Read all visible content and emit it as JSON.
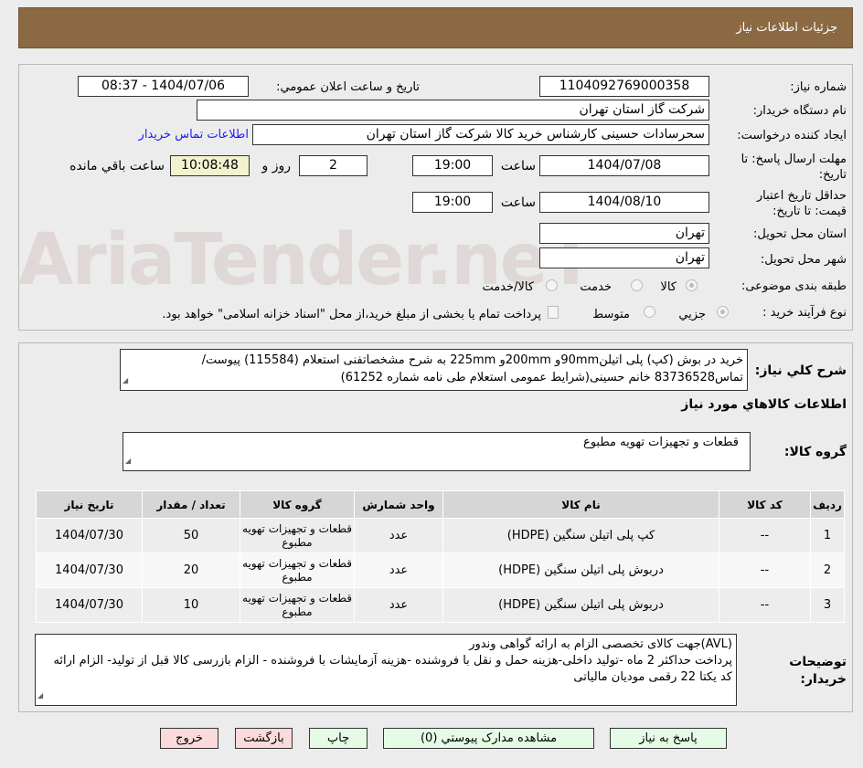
{
  "header": {
    "title": "جزئيات اطلاعات نياز"
  },
  "watermark": "AriaTender.neT",
  "form": {
    "need_number_label": "شماره نياز:",
    "need_number": "1104092769000358",
    "announce_label": "تاريخ و ساعت اعلان عمومي:",
    "announce_value": "1404/07/06 - 08:37",
    "buyer_org_label": "نام دستگاه خريدار:",
    "buyer_org": "شرکت گاز استان تهران",
    "creator_label": "ايجاد کننده درخواست:",
    "creator": "سحرسادات حسینی کارشناس خرید کالا شرکت گاز استان تهران",
    "contact_link": "اطلاعات تماس خريدار",
    "reply_deadline_label": "مهلت ارسال پاسخ: تا تاريخ:",
    "reply_date": "1404/07/08",
    "time_label": "ساعت",
    "reply_time": "19:00",
    "days": "2",
    "days_label": "روز و",
    "remaining_time": "10:08:48",
    "remaining_label": "ساعت باقي مانده",
    "validity_label": "حداقل تاريخ اعتبار قيمت: تا تاريخ:",
    "validity_date": "1404/08/10",
    "validity_time": "19:00",
    "province_label": "استان محل تحويل:",
    "province": "تهران",
    "city_label": "شهر محل تحويل:",
    "city": "تهران",
    "category_label": "طبقه بندی موضوعی:",
    "category_options": [
      "کالا",
      "خدمت",
      "کالا/خدمت"
    ],
    "process_label": "نوع فرآيند خريد :",
    "process_options": [
      "جزيي",
      "متوسط"
    ],
    "process_note": "پرداخت تمام يا بخشی از مبلغ خريد،از محل \"اسناد خزانه اسلامی\" خواهد بود."
  },
  "summary": {
    "label": "شرح کلي نياز:",
    "text": "خرید در بوش (کپ) پلی اتیلن90mmو 200mmو 225mm به شرح مشخصاتفنی استعلام (115584) پیوست/تماس83736528 خانم حسینی(شرایط عمومی استعلام طی نامه شماره 61252)"
  },
  "goods_title": "اطلاعات کالاهاي مورد نياز",
  "group": {
    "label": "گروه کالا:",
    "value": "قطعات و تجهیزات تهویه مطبوع"
  },
  "table": {
    "headers": [
      "رديف",
      "کد کالا",
      "نام کالا",
      "واحد شمارش",
      "گروه کالا",
      "تعداد / مقدار",
      "تاريخ نياز"
    ],
    "rows": [
      [
        "1",
        "--",
        "کپ پلی اتیلن سنگین (HDPE)",
        "عدد",
        "قطعات و تجهیزات تهویه مطبوع",
        "50",
        "1404/07/30"
      ],
      [
        "2",
        "--",
        "دربوش پلی اتیلن سنگین (HDPE)",
        "عدد",
        "قطعات و تجهیزات تهویه مطبوع",
        "20",
        "1404/07/30"
      ],
      [
        "3",
        "--",
        "دربوش پلی اتیلن سنگین (HDPE)",
        "عدد",
        "قطعات و تجهیزات تهویه مطبوع",
        "10",
        "1404/07/30"
      ]
    ]
  },
  "notes": {
    "label": "توضيحات خريدار:",
    "lines": [
      "(AVL)جهت کالای تخصصی الزام به ارائه گواهی وندور",
      "پرداخت حداکثر 2 ماه -تولید داخلی-هزینه حمل و نقل با فروشنده -هزینه آزمایشات با فروشنده - الزام بازرسی کالا قبل از تولید- الزام ارائه کد یکتا 22 رقمی مودیان مالیاتی"
    ]
  },
  "buttons": {
    "reply": "پاسخ به نياز",
    "docs": "مشاهده مدارک پيوستي (0)",
    "print": "چاپ",
    "back": "بازگشت",
    "exit": "خروج"
  }
}
